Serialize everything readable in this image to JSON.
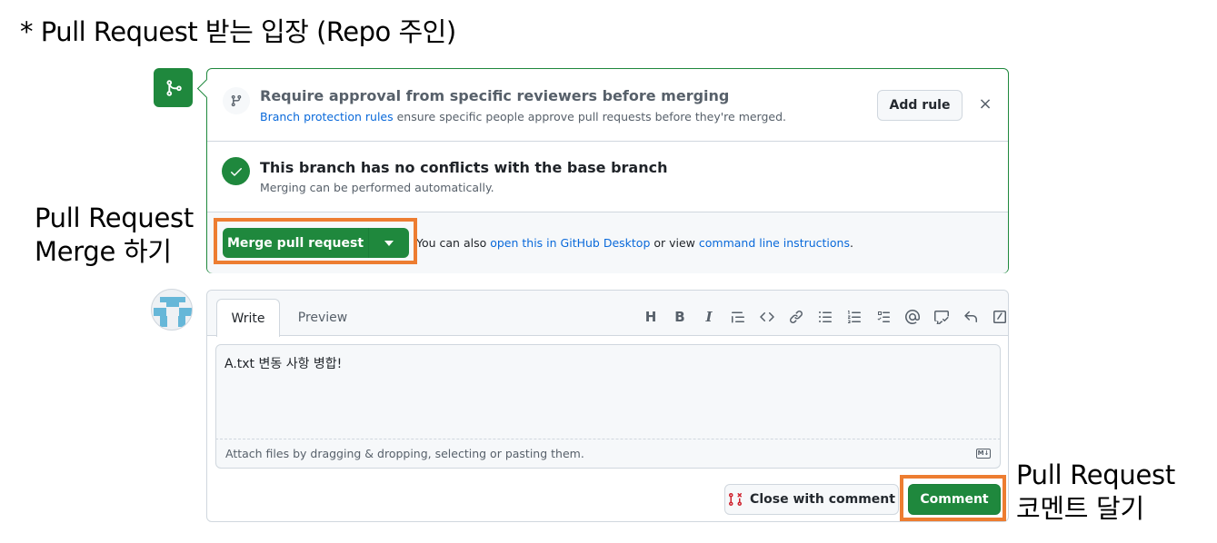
{
  "heading": "* Pull Request 받는 입장 (Repo 주인)",
  "annotations": {
    "merge_line1": "Pull Request",
    "merge_line2": "Merge 하기",
    "comment_line1": "Pull Request",
    "comment_line2": "코멘트 달기",
    "highlight_color": "#ed7d31"
  },
  "merge_panel": {
    "rule_title": "Require approval from specific reviewers before merging",
    "rule_link": "Branch protection rules",
    "rule_text": " ensure specific people approve pull requests before they're merged.",
    "add_rule_label": "Add rule",
    "close_icon": "×",
    "conflict_title": "This branch has no conflicts with the base branch",
    "conflict_sub": "Merging can be performed automatically.",
    "merge_button_label": "Merge pull request",
    "hint_prefix": "You can also ",
    "hint_link1": "open this in GitHub Desktop",
    "hint_mid": " or view ",
    "hint_link2": "command line instructions",
    "hint_suffix": "."
  },
  "comment_panel": {
    "tabs": [
      "Write",
      "Preview"
    ],
    "toolbar_icons": [
      "heading-icon",
      "bold-icon",
      "italic-icon",
      "quote-icon",
      "code-icon",
      "link-icon",
      "unordered-list-icon",
      "ordered-list-icon",
      "task-list-icon",
      "mention-icon",
      "reference-icon",
      "reply-icon",
      "slash-command-icon"
    ],
    "toolbar_glyphs": [
      "H",
      "B",
      "I"
    ],
    "comment_text": "A.txt 변동 사항 병합!",
    "attach_hint": "Attach files by dragging & dropping, selecting or pasting them.",
    "markdown_badge": "M↓",
    "close_with_comment_label": "Close with comment",
    "comment_button_label": "Comment"
  },
  "colors": {
    "github_green": "#1f883d",
    "link_blue": "#0969da",
    "border_gray": "#d0d7de",
    "muted_text": "#57606a"
  }
}
